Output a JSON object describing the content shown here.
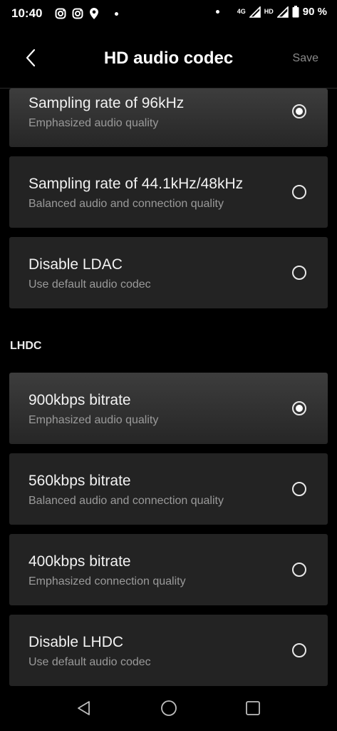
{
  "status_bar": {
    "time": "10:40",
    "network": "4G",
    "hd": "HD",
    "battery": "90 %",
    "left_icons": [
      "instagram-icon",
      "instagram-icon",
      "location-icon",
      "dot"
    ],
    "right_icons": [
      "dot",
      "signal-icon",
      "signal-icon",
      "battery-icon"
    ]
  },
  "header": {
    "title": "HD audio codec",
    "save_label": "Save",
    "back_icon": "chevron-left-icon"
  },
  "ldac": {
    "options": [
      {
        "title": "Sampling rate of 96kHz",
        "subtitle": "Emphasized audio quality",
        "selected": true
      },
      {
        "title": "Sampling rate of 44.1kHz/48kHz",
        "subtitle": "Balanced audio and connection quality",
        "selected": false
      },
      {
        "title": "Disable LDAC",
        "subtitle": "Use default audio codec",
        "selected": false
      }
    ]
  },
  "lhdc": {
    "section_label": "LHDC",
    "options": [
      {
        "title": "900kbps bitrate",
        "subtitle": "Emphasized audio quality",
        "selected": true
      },
      {
        "title": "560kbps bitrate",
        "subtitle": "Balanced audio and connection quality",
        "selected": false
      },
      {
        "title": "400kbps bitrate",
        "subtitle": "Emphasized connection quality",
        "selected": false
      },
      {
        "title": "Disable LHDC",
        "subtitle": "Use default audio codec",
        "selected": false
      }
    ]
  },
  "nav_bar": {
    "icons": [
      "back-triangle-icon",
      "home-circle-icon",
      "recents-square-icon"
    ]
  },
  "colors": {
    "background": "#000000",
    "card": "#232323",
    "muted_text": "#9a9a9a"
  }
}
